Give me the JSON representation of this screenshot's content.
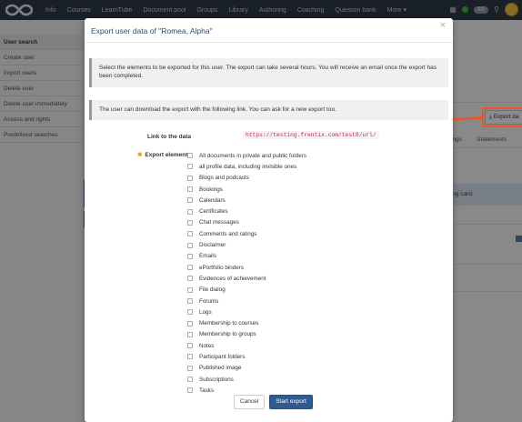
{
  "nav": {
    "items": [
      "Info",
      "Courses",
      "LearnTube",
      "Document pool",
      "Groups",
      "Library",
      "Authoring",
      "Coaching",
      "Question bank",
      "More ▾"
    ],
    "pill": "0/0"
  },
  "sidebar": {
    "items": [
      "User search",
      "Create user",
      "Import users",
      "Delete user",
      "Delete user immediately",
      "Access and rights",
      "Predefined searches"
    ]
  },
  "background": {
    "export_button": "Export da",
    "tabs": [
      "ings",
      "Statements"
    ],
    "sticky_text": "ting card."
  },
  "modal": {
    "title": "Export user data of \"Romea, Alpha\"",
    "close": "×",
    "info1": "Select the elements to be exported for this user. The export can take several hours. You will receive an email once the export has been completed.",
    "info2": "The user can download the export with the following link. You can ask for a new export too.",
    "link_label": "Link to the data",
    "link_value": "https://testing.frentix.com/test8/url/",
    "export_label": "Export elements",
    "elements": [
      "All documents in private and public folders",
      "all profile data, including invisible ones",
      "Blogs and podcasts",
      "Bookings",
      "Calendars",
      "Certificates",
      "Chat messages",
      "Comments and ratings",
      "Disclaimer",
      "Emails",
      "ePortfolio binders",
      "Evidences of achievement",
      "File dialog",
      "Forums",
      "Logs",
      "Membership to courses",
      "Membership to groups",
      "Notes",
      "Participant folders",
      "Published image",
      "Subscriptions",
      "Tasks"
    ],
    "cancel_label": "Cancel",
    "start_label": "Start export"
  },
  "colors": {
    "nav_bg": "#2f3b48",
    "title": "#2b4a6a",
    "primary_btn": "#2f5b8f",
    "highlight": "#e8562b"
  }
}
